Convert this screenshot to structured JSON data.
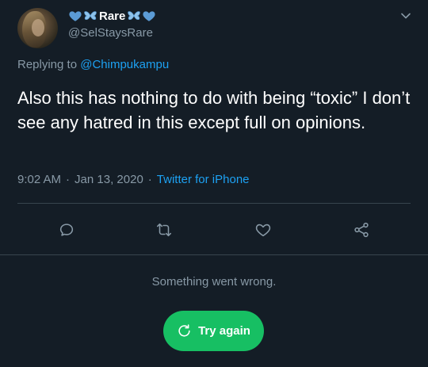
{
  "author": {
    "display_name": "Rare",
    "handle": "@SelStaysRare",
    "name_icons": [
      "blue-heart-icon",
      "butterfly-icon",
      "butterfly-icon",
      "blue-heart-icon"
    ]
  },
  "reply": {
    "prefix": "Replying to",
    "mention": "@Chimpukampu"
  },
  "tweet": {
    "text": "Also this has nothing to do with being “toxic” I don’t see any hatred in this except full on opinions."
  },
  "meta": {
    "time": "9:02 AM",
    "separator": "·",
    "date": "Jan 13, 2020",
    "source": "Twitter for iPhone"
  },
  "actions": [
    {
      "name": "reply-icon"
    },
    {
      "name": "retweet-icon"
    },
    {
      "name": "like-icon"
    },
    {
      "name": "share-icon"
    }
  ],
  "error": {
    "message": "Something went wrong.",
    "retry_label": "Try again"
  },
  "colors": {
    "background": "#141d26",
    "primary_text": "#ffffff",
    "secondary_text": "#8899a6",
    "link": "#1da1f2",
    "heart": "#5b9bd5",
    "retry_button": "#17bf63",
    "divider": "#38444d"
  }
}
